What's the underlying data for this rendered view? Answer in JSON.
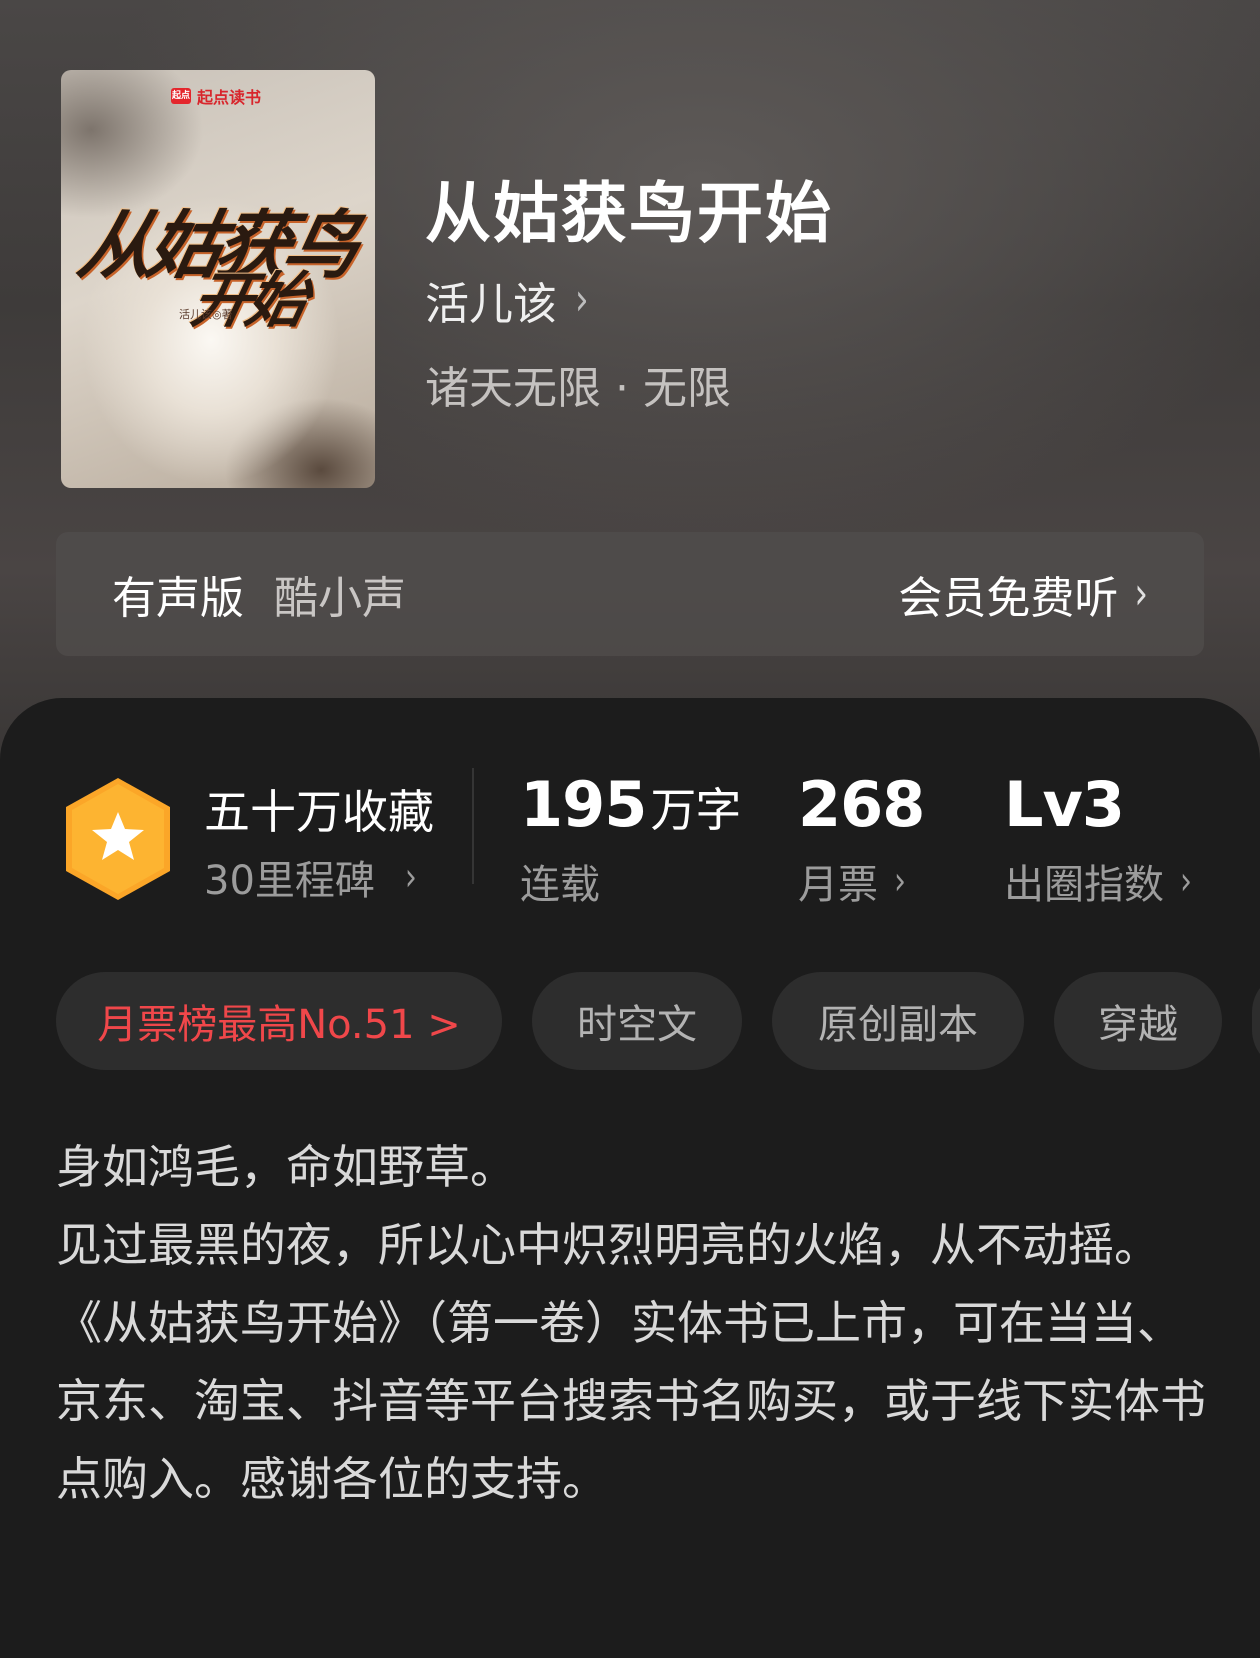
{
  "book": {
    "title": "从姑获鸟开始",
    "author": "活儿该",
    "category": "诸天无限 · 无限"
  },
  "cover": {
    "brand": "起点读书",
    "title_line1": "从姑获鸟",
    "title_line2": "开始",
    "author_credit": "活儿该◎著"
  },
  "audio": {
    "label": "有声版",
    "narrator": "酷小声",
    "cta": "会员免费听"
  },
  "stats": {
    "favorites_title": "五十万收藏",
    "favorites_sub": "30里程碑",
    "words_value": "195",
    "words_unit": "万字",
    "words_label": "连载",
    "tickets_value": "268",
    "tickets_label": "月票",
    "level_value": "Lv3",
    "level_label": "出圈指数"
  },
  "tags": {
    "rank": "月票榜最高No.51 >",
    "items": [
      "时空文",
      "原创副本",
      "穿越"
    ]
  },
  "synopsis": [
    "身如鸿毛，命如野草。",
    "见过最黑的夜，所以心中炽烈明亮的火焰，从不动摇。",
    "《从姑获鸟开始》（第一卷）实体书已上市，可在当当、京东、淘宝、抖音等平台搜索书名购买，或于线下实体书点购入。感谢各位的支持。"
  ],
  "colors": {
    "rank_red": "#f0474a",
    "badge_orange": "#fba628"
  }
}
